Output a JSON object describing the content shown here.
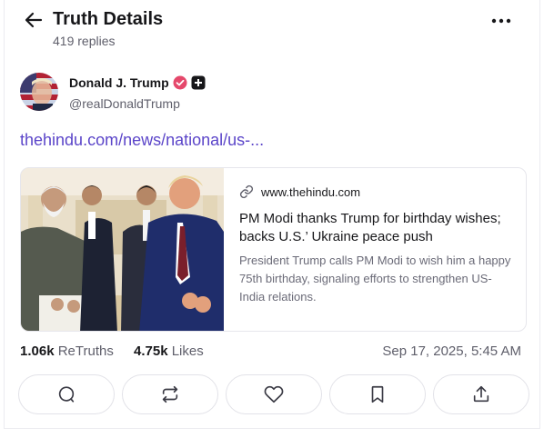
{
  "header": {
    "title": "Truth Details",
    "replies": "419 replies"
  },
  "author": {
    "name": "Donald J. Trump",
    "handle": "@realDonaldTrump"
  },
  "post": {
    "link_text": "thehindu.com/news/national/us-..."
  },
  "card": {
    "domain": "www.thehindu.com",
    "title": "PM Modi thanks Trump for birthday wishes; backs U.S.’ Ukraine peace push",
    "description": "President Trump calls PM Modi to wish him a happy 75th birthday, signaling efforts to strengthen US-India relations."
  },
  "stats": {
    "retruths_count": "1.06k",
    "retruths_label": "ReTruths",
    "likes_count": "4.75k",
    "likes_label": "Likes",
    "timestamp": "Sep 17, 2025, 5:45 AM"
  },
  "icons": {
    "back": "arrow-left-icon",
    "more": "more-horizontal-icon",
    "verified": "verified-badge-icon",
    "plus": "plus-badge-icon",
    "link": "link-icon",
    "reply": "comment-icon",
    "retruth": "repost-icon",
    "like": "heart-icon",
    "bookmark": "bookmark-icon",
    "share": "share-icon"
  },
  "colors": {
    "link": "#5b45c9",
    "verified": "#e5486b",
    "text": "#17171a",
    "muted": "#5f5f6b"
  }
}
